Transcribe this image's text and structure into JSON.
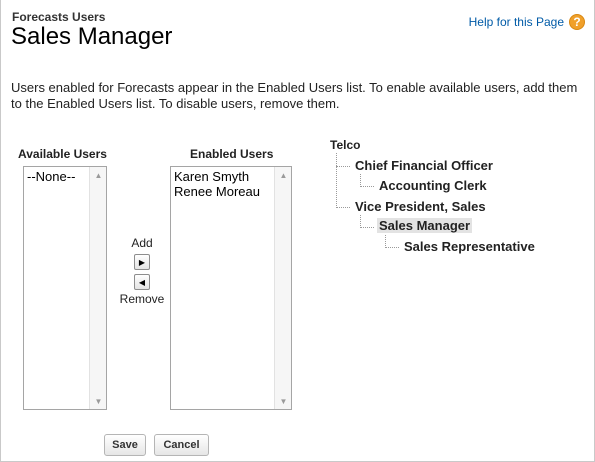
{
  "header": {
    "subtitle": "Forecasts Users",
    "title": "Sales Manager",
    "help_label": "Help for this Page",
    "help_icon": "help-question-icon"
  },
  "description": "Users enabled for Forecasts appear in the Enabled Users list. To enable available users, add them to the Enabled Users list. To disable users, remove them.",
  "available": {
    "label": "Available Users",
    "options": [
      "--None--"
    ]
  },
  "enabled": {
    "label": "Enabled Users",
    "options": [
      "Karen Smyth",
      "Renee Moreau"
    ]
  },
  "mover": {
    "add_label": "Add",
    "remove_label": "Remove",
    "add_icon": "arrow-right-icon",
    "remove_icon": "arrow-left-icon"
  },
  "role_tree": {
    "root": "Telco",
    "nodes": [
      "Chief Financial Officer",
      "Accounting Clerk",
      "Vice President, Sales",
      "Sales Manager",
      "Sales Representative"
    ],
    "selected": "Sales Manager"
  },
  "actions": {
    "save_label": "Save",
    "cancel_label": "Cancel"
  },
  "colors": {
    "link": "#015ba7",
    "help_icon": "#f0a02a",
    "selected_bg": "#e3e3e3"
  }
}
